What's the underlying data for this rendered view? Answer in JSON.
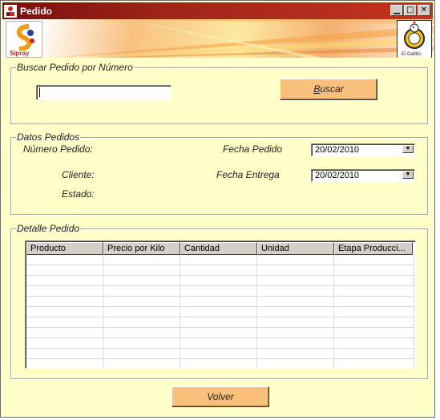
{
  "window": {
    "title": "Pedido",
    "controls": [
      "minimize",
      "maximize",
      "close"
    ]
  },
  "banner": {
    "left_logo_text": "Sipray",
    "right_logo_text": "El Gallito"
  },
  "search_section": {
    "legend": "Buscar Pedido por Número",
    "input_value": "",
    "button_label": "Buscar",
    "button_mnemonic": "B"
  },
  "details_section": {
    "legend": "Datos Pedidos",
    "numero_label": "Número Pedido:",
    "cliente_label": "Cliente:",
    "estado_label": "Estado:",
    "fecha_pedido_label": "Fecha Pedido",
    "fecha_pedido_value": "20/02/2010",
    "fecha_entrega_label": "Fecha Entrega",
    "fecha_entrega_value": "20/02/2010"
  },
  "detalle_section": {
    "legend": "Detalle Pedido",
    "columns": [
      "Producto",
      "Precio por Kilo",
      "Cantidad",
      "Unidad",
      "Etapa Producci..."
    ],
    "rows": 11
  },
  "footer": {
    "volver_label": "Volver"
  },
  "colors": {
    "window_bg": "#ffffc8",
    "title_bar": "#a02618",
    "button_orange": "#fbbf7c"
  }
}
